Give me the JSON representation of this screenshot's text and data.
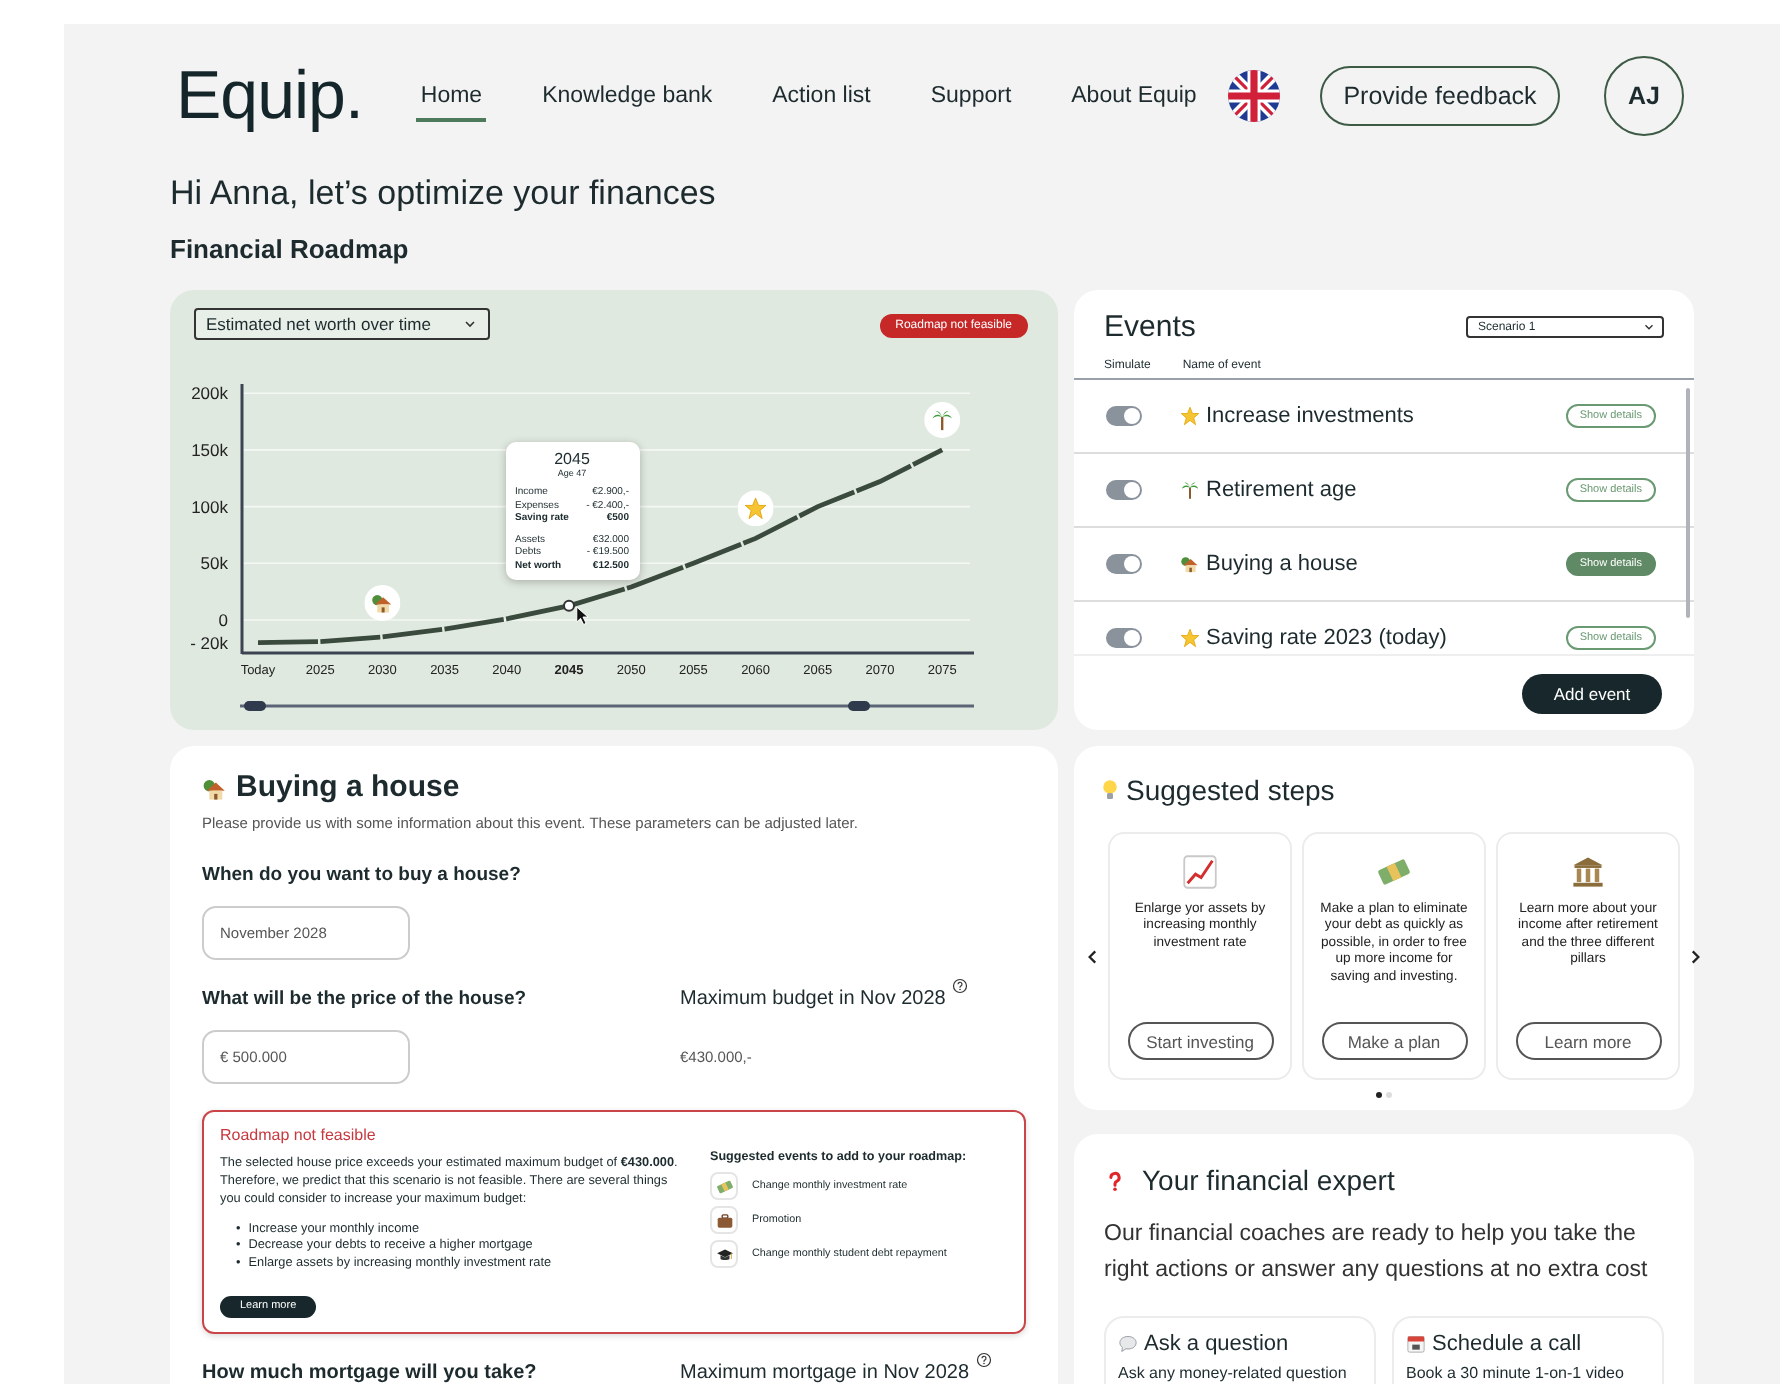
{
  "header": {
    "logo": "Equip.",
    "nav": [
      {
        "label": "Home",
        "selected": true
      },
      {
        "label": "Knowledge bank",
        "selected": false
      },
      {
        "label": "Action list",
        "selected": false
      },
      {
        "label": "Support",
        "selected": false
      },
      {
        "label": "About Equip",
        "selected": false
      }
    ],
    "feedback_button": "Provide feedback",
    "avatar": "AJ"
  },
  "greeting": "Hi Anna, let’s optimize your finances",
  "section_title": "Financial Roadmap",
  "roadmap": {
    "dropdown": "Estimated net worth over time",
    "badge": "Roadmap not feasible",
    "chart_data": {
      "type": "line",
      "categories": [
        "Today",
        "2025",
        "2030",
        "2035",
        "2040",
        "2045",
        "2050",
        "2055",
        "2060",
        "2065",
        "2070",
        "2075"
      ],
      "values": [
        -20000,
        -19000,
        -15000,
        -8000,
        1000,
        12500,
        29000,
        50000,
        72000,
        100000,
        122000,
        150000
      ],
      "ylim": [
        -30000,
        200000
      ],
      "grid": true,
      "line_style": "dashed",
      "yticks": [
        {
          "value": 200000,
          "label": "200k"
        },
        {
          "value": 150000,
          "label": "150k"
        },
        {
          "value": 100000,
          "label": "100k"
        },
        {
          "value": 50000,
          "label": "50k"
        },
        {
          "value": 0,
          "label": "0"
        },
        {
          "value": -20000,
          "label": "- 20k"
        }
      ]
    },
    "points": [
      {
        "kind": "plain",
        "selected": false
      },
      {
        "kind": "plain",
        "selected": false
      },
      {
        "kind": "house",
        "selected": false
      },
      {
        "kind": "plain",
        "selected": false
      },
      {
        "kind": "plain",
        "selected": false
      },
      {
        "kind": "plain",
        "selected": true
      },
      {
        "kind": "plain",
        "selected": false
      },
      {
        "kind": "plain",
        "selected": false
      },
      {
        "kind": "star",
        "selected": false
      },
      {
        "kind": "plain",
        "selected": false
      },
      {
        "kind": "plain",
        "selected": false
      },
      {
        "kind": "palm",
        "selected": false
      }
    ],
    "tooltip": {
      "title": "2045",
      "subtitle": "Age 47",
      "sections": [
        {
          "rows": [
            {
              "label": "Income",
              "value": "€2.900,-",
              "emphasis": false
            },
            {
              "label": "Expenses",
              "value": "- €2.400,-",
              "emphasis": false
            },
            {
              "label": "Saving rate",
              "value": "€500",
              "emphasis": true
            }
          ]
        },
        {
          "rows": [
            {
              "label": "Assets",
              "value": "€32.000",
              "emphasis": false
            },
            {
              "label": "Debts",
              "value": "- €19.500",
              "emphasis": false
            },
            {
              "label": "Net worth",
              "value": "€12.500",
              "emphasis": true
            }
          ]
        }
      ]
    }
  },
  "events": {
    "title": "Events",
    "scenario": "Scenario 1",
    "columns": [
      "Simulate",
      "Name of event"
    ],
    "rows": [
      {
        "on": true,
        "kind": "star",
        "name": "Increase investments",
        "details": "Show details",
        "selected": false
      },
      {
        "on": true,
        "kind": "palm",
        "name": "Retirement age",
        "details": "Show details",
        "selected": false
      },
      {
        "on": true,
        "kind": "house",
        "name": "Buying a house",
        "details": "Show details",
        "selected": true
      },
      {
        "on": true,
        "kind": "star",
        "name": "Saving rate 2023 (today)",
        "details": "Show details",
        "selected": false
      }
    ],
    "add_button": "Add event"
  },
  "event_form": {
    "title": "Buying a house",
    "description": "Please provide us with some information about this event. These parameters can be adjusted later.",
    "date_question": "When do you want to buy a house?",
    "date_value": "November 2028",
    "price_question": "What will be the price of the house?",
    "budget_label": "Maximum budget in Nov 2028",
    "price_value": "€ 500.000",
    "budget_value": "€430.000,-",
    "alert": {
      "title": "Roadmap not feasible",
      "text": "The selected house price exceeds your estimated maximum budget of **€430.000**. Therefore, we predict that this scenario is not feasible. There are several things you could consider to increase your maximum budget:",
      "bullet": "•",
      "tips": [
        "Increase your  monthly income",
        "Decrease your debts to receive a higher mortgage",
        "Enlarge assets by increasing monthly investment rate"
      ],
      "button": "Learn more",
      "suggestions_title": "Suggested events to add to your roadmap:",
      "suggestions": [
        {
          "kind": "money",
          "label": "Change monthly investment rate"
        },
        {
          "kind": "briefcase",
          "label": "Promotion"
        },
        {
          "kind": "graduation",
          "label": "Change monthly student debt repayment"
        }
      ]
    },
    "mortgage_question": "How much mortgage will you take?",
    "mortgage_label": "Maximum mortgage in Nov 2028"
  },
  "suggested_steps": {
    "title": "Suggested steps",
    "cards": [
      {
        "kind": "chart",
        "text": "Enlarge yor assets by increasing monthly investment rate",
        "button": "Start investing"
      },
      {
        "kind": "money",
        "text": "Make a plan to eliminate your debt as quickly as possible, in order to free up more income for saving and investing.",
        "button": "Make a plan"
      },
      {
        "kind": "bank",
        "text": "Learn more about your income after retirement and the three different pillars",
        "button": "Learn more"
      }
    ],
    "pages": [
      {
        "selected": true
      },
      {
        "selected": false
      }
    ]
  },
  "expert": {
    "title": "Your financial expert",
    "text": "Our financial coaches are ready to help you take the right actions or answer any questions at no extra cost",
    "cards": [
      {
        "kind": "chat",
        "title": "Ask a question",
        "text": "Ask any money-related question"
      },
      {
        "kind": "calendar",
        "title": "Schedule a call",
        "text": "Book a 30 minute 1-on-1 video"
      }
    ]
  }
}
